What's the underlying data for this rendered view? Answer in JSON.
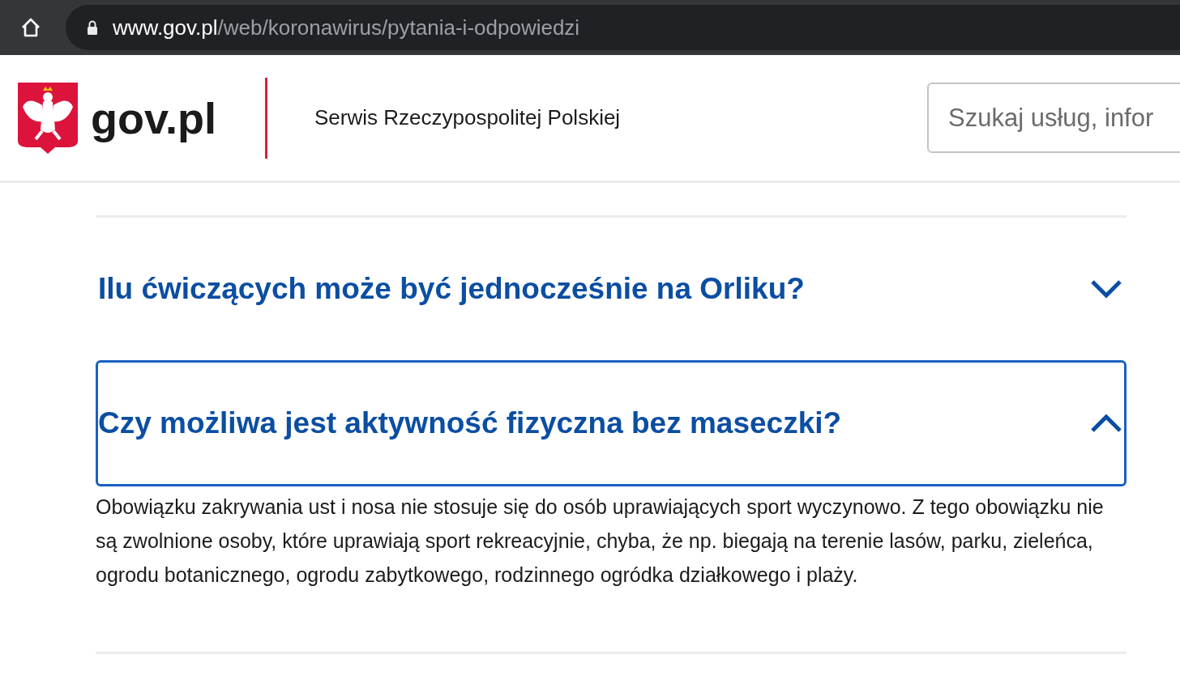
{
  "browser": {
    "url_host": "www.gov.pl",
    "url_path": "/web/koronawirus/pytania-i-odpowiedzi"
  },
  "header": {
    "logo_text": "gov.pl",
    "tagline": "Serwis Rzeczypospolitej Polskiej",
    "search": {
      "placeholder": "Szukaj usług, infor"
    }
  },
  "faq": [
    {
      "question": "Ilu ćwiczących może być jednocześnie na Orliku?",
      "expanded": false
    },
    {
      "question": "Czy możliwa jest aktywność fizyczna bez maseczki?",
      "expanded": true,
      "answer": "Obowiązku zakrywania ust i nosa nie stosuje się do osób uprawiających sport wyczynowo. Z tego obowiązku nie są zwolnione osoby, które uprawiają sport rekreacyjnie, chyba, że np. biegają na terenie lasów, parku, zieleńca, ogrodu botanicznego, ogrodu zabytkowego, rodzinnego ogródka działkowego i plaży."
    }
  ]
}
